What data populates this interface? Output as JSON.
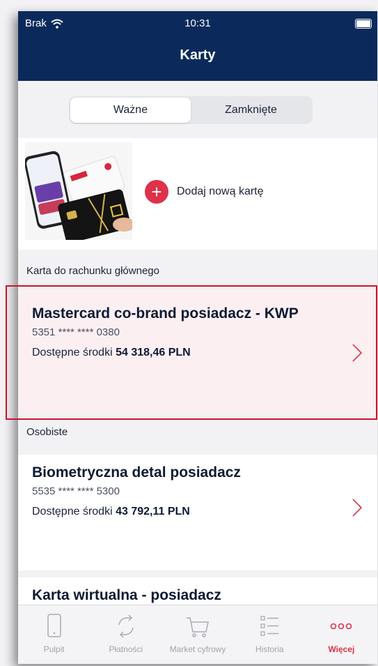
{
  "status_bar": {
    "carrier": "Brak",
    "time": "10:31"
  },
  "header": {
    "title": "Karty"
  },
  "segment": {
    "active": "Ważne",
    "inactive": "Zamknięte"
  },
  "add_card": {
    "label": "Dodaj nową kartę"
  },
  "sections": {
    "main": "Karta do rachunku głównego",
    "personal": "Osobiste"
  },
  "cards": [
    {
      "name": "Mastercard co-brand posiadacz - KWP",
      "number": "5351 **** **** 0380",
      "funds_label": "Dostępne środki",
      "funds_value": "54 318,46 PLN"
    },
    {
      "name": "Biometryczna detal posiadacz",
      "number": "5535 **** **** 5300",
      "funds_label": "Dostępne środki",
      "funds_value": "43 792,11 PLN"
    },
    {
      "name": "Karta wirtualna - posiadacz"
    }
  ],
  "tabbar": [
    {
      "label": "Pulpit",
      "icon": "phone-icon"
    },
    {
      "label": "Płatności",
      "icon": "sync-icon"
    },
    {
      "label": "Market cyfrowy",
      "icon": "cart-icon"
    },
    {
      "label": "Historia",
      "icon": "list-icon"
    },
    {
      "label": "Więcej",
      "icon": "more-icon"
    }
  ],
  "colors": {
    "navy": "#0b2a5b",
    "accent": "#e0304a",
    "highlight_bg": "#fbeff1"
  }
}
